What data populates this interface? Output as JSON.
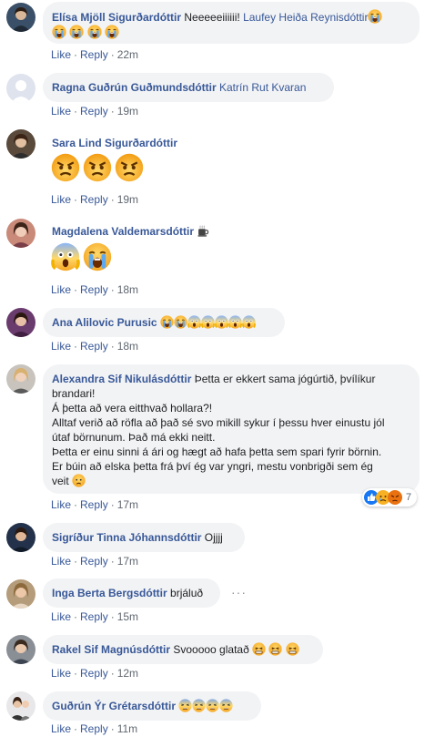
{
  "comments": [
    {
      "name": "Elísa Mjöll Sigurðardóttir",
      "text": "Neeeeeiiiiii! ",
      "tag": "Laufey Heiða Reynisdóttir",
      "like": "Like",
      "reply": "Reply",
      "time": "22m"
    },
    {
      "name": "Ragna Guðrún Guðmundsdóttir",
      "tag": "Katrín Rut Kvaran",
      "like": "Like",
      "reply": "Reply",
      "time": "19m"
    },
    {
      "name": "Sara Lind Sigurðardóttir",
      "like": "Like",
      "reply": "Reply",
      "time": "19m"
    },
    {
      "name": "Magdalena Valdemarsdóttir",
      "like": "Like",
      "reply": "Reply",
      "time": "18m"
    },
    {
      "name": "Ana Alilovic Purusic",
      "like": "Like",
      "reply": "Reply",
      "time": "18m"
    },
    {
      "name": "Alexandra Sif Nikulásdóttir",
      "lines": [
        " Þetta er ekkert sama jógúrtið, þvílíkur",
        "brandari!",
        "Á þetta að vera eitthvað hollara?!",
        "Alltaf verið að röfla að það sé svo mikill sykur í þessu hver einustu jól",
        "útaf börnunum. Það má ekki neitt.",
        "Þetta er einu sinni á ári og hægt að hafa þetta sem spari fyrir börnin.",
        "Er búin að elska þetta frá því ég var yngri, mestu vonbrigði sem ég",
        "veit "
      ],
      "reaction_count": "7",
      "like": "Like",
      "reply": "Reply",
      "time": "17m"
    },
    {
      "name": "Sigríður Tinna Jóhannsdóttir",
      "text": " Ojjjj",
      "like": "Like",
      "reply": "Reply",
      "time": "17m"
    },
    {
      "name": "Inga Berta Bergsdóttir",
      "text": " brjáluð",
      "more": "···",
      "like": "Like",
      "reply": "Reply",
      "time": "15m"
    },
    {
      "name": "Rakel Sif Magnúsdóttir",
      "text": " Svooooo glatað ",
      "like": "Like",
      "reply": "Reply",
      "time": "12m"
    },
    {
      "name": "Guðrún Ýr Grétarsdóttir",
      "like": "Like",
      "reply": "Reply",
      "time": "11m"
    }
  ],
  "colors": {
    "link": "#385898",
    "bubble": "#f2f3f5",
    "meta": "#606770",
    "emoji": "#f7b125"
  }
}
